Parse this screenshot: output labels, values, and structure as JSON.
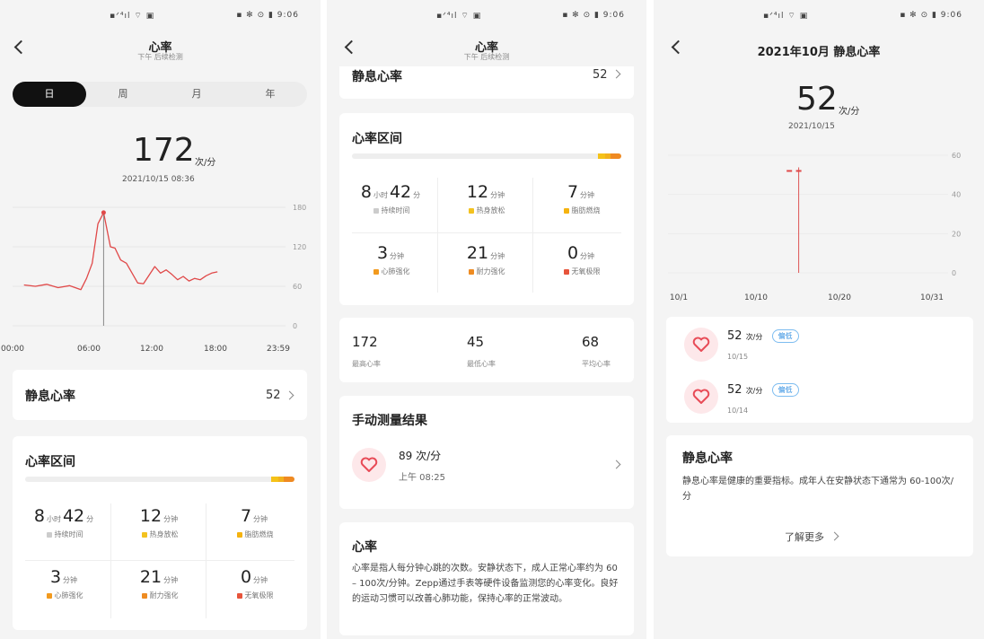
{
  "status_bar": {
    "left": "▪ᐟ⁴ıl ⌔ ▣",
    "right": "▪ ✻ ⊙ ▮ 9:06"
  },
  "screen1": {
    "title": "心率",
    "subtitle": "下午 后续检测",
    "tabs": [
      "日",
      "周",
      "月",
      "年"
    ],
    "bpm": "172",
    "unit": "次/分",
    "datetime": "2021/10/15 08:36",
    "y_ticks": [
      "180",
      "120",
      "60",
      "0"
    ],
    "x_ticks": [
      "00:00",
      "06:00",
      "12:00",
      "18:00",
      "23:59"
    ],
    "resting": {
      "label": "静息心率",
      "value": "52"
    },
    "zones": {
      "title": "心率区间",
      "cells": [
        {
          "big": "8",
          "mid": "小时",
          "big2": "42",
          "small": "分",
          "label": "持续时间",
          "color": "#cccccc"
        },
        {
          "big": "12",
          "mid": "",
          "big2": "",
          "small": "分钟",
          "label": "热身放松",
          "color": "#f3c21f"
        },
        {
          "big": "7",
          "mid": "",
          "big2": "",
          "small": "分钟",
          "label": "脂肪燃烧",
          "color": "#f5b30f"
        },
        {
          "big": "3",
          "mid": "",
          "big2": "",
          "small": "分钟",
          "label": "心肺强化",
          "color": "#f29a1e"
        },
        {
          "big": "21",
          "mid": "",
          "big2": "",
          "small": "分钟",
          "label": "耐力强化",
          "color": "#ee8b22"
        },
        {
          "big": "0",
          "mid": "",
          "big2": "",
          "small": "分钟",
          "label": "无氧极限",
          "color": "#e7543b"
        }
      ]
    }
  },
  "screen2": {
    "title": "心率",
    "subtitle": "下午 后续检测",
    "resting": {
      "label": "静息心率",
      "value": "52"
    },
    "stats": [
      {
        "value": "172",
        "label": "最高心率"
      },
      {
        "value": "45",
        "label": "最低心率"
      },
      {
        "value": "68",
        "label": "平均心率"
      }
    ],
    "manual": {
      "title": "手动测量结果",
      "value": "89 次/分",
      "time": "上午 08:25"
    },
    "info": {
      "title": "心率",
      "text": "心率是指人每分钟心跳的次数。安静状态下，成人正常心率约为 60 – 100次/分钟。Zepp通过手表等硬件设备监测您的心率变化。良好的运动习惯可以改善心肺功能，保持心率的正常波动。"
    }
  },
  "screen3": {
    "title": "2021年10月 静息心率",
    "bpm": "52",
    "unit": "次/分",
    "date": "2021/10/15",
    "y_ticks": [
      "60",
      "40",
      "20",
      "0"
    ],
    "x_ticks": [
      "10/1",
      "10/10",
      "10/20",
      "10/31"
    ],
    "records": [
      {
        "value": "52",
        "unit": "次/分",
        "tag": "偏低",
        "date": "10/15"
      },
      {
        "value": "52",
        "unit": "次/分",
        "tag": "偏低",
        "date": "10/14"
      }
    ],
    "info": {
      "title": "静息心率",
      "text": "静息心率是健康的重要指标。成年人在安静状态下通常为 60-100次/分",
      "more": "了解更多"
    }
  },
  "chart_data": [
    {
      "type": "line",
      "title": "",
      "x_range": [
        "00:00",
        "23:59"
      ],
      "ylim": [
        0,
        180
      ],
      "grid": true,
      "series": [
        {
          "x": [
            "01:00",
            "02:00",
            "03:00",
            "04:00",
            "05:00",
            "06:00",
            "06:30",
            "07:00",
            "07:30",
            "08:00",
            "08:36",
            "09:00",
            "09:30",
            "10:00",
            "11:00",
            "11:30",
            "12:30",
            "13:00",
            "13:30",
            "14:00",
            "14:30",
            "15:00",
            "15:30",
            "16:00",
            "16:30",
            "17:00",
            "17:30",
            "18:00"
          ],
          "values": [
            62,
            60,
            63,
            58,
            61,
            55,
            72,
            95,
            155,
            172,
            120,
            118,
            100,
            95,
            65,
            64,
            90,
            80,
            85,
            78,
            70,
            75,
            68,
            72,
            70,
            76,
            80,
            82
          ]
        }
      ]
    },
    {
      "type": "scatter",
      "title": "2021年10月 静息心率",
      "x_range": [
        "10/1",
        "10/31"
      ],
      "ylim": [
        0,
        60
      ],
      "grid": true,
      "series": [
        {
          "x": [
            "10/14",
            "10/15"
          ],
          "values": [
            52,
            52
          ]
        }
      ]
    }
  ]
}
